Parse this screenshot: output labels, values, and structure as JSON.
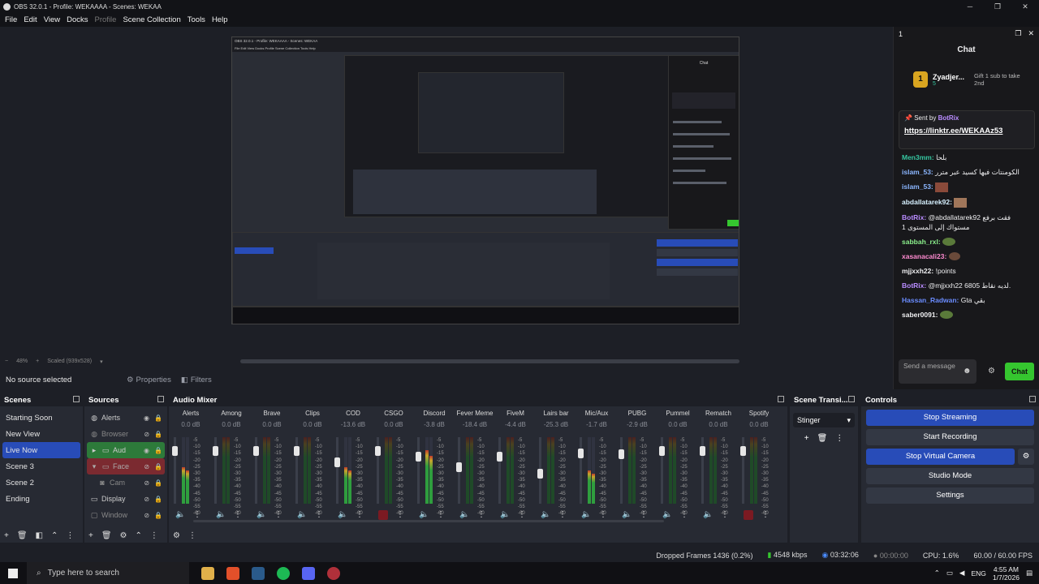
{
  "window": {
    "title": "OBS 32.0.1 - Profile: WEKAAAA - Scenes: WEKAA",
    "min_glyph": "─",
    "max_glyph": "❐",
    "close_glyph": "✕"
  },
  "menu": [
    "File",
    "Edit",
    "View",
    "Docks",
    "Profile",
    "Scene Collection",
    "Tools",
    "Help"
  ],
  "preview": {
    "zoom": "48%",
    "scaled": "Scaled (939x528)",
    "nested_title": "OBS 32.0.1 - Profile: WEKAAAA - Scenes: WEKAA",
    "nested_menu": "File Edit View Docks Profile Scene Collection Tools Help",
    "nested_chat_title": "Chat"
  },
  "source_toolbar": {
    "no_source": "No source selected",
    "properties": "Properties",
    "filters": "Filters"
  },
  "chat": {
    "dock_number": "1",
    "title": "Chat",
    "gift_user": "Zyadjer...",
    "gift_count": "5",
    "gift_text": "Gift 1 sub to take 2nd",
    "pinned_by_label": "Sent by",
    "pinned_by_user": "BotRix",
    "pinned_url": "https://linktr.ee/WEKAAz53",
    "messages": [
      {
        "user": "Men3mm:",
        "text": "بلحا",
        "color": "#35c6a0"
      },
      {
        "user": "islam_53:",
        "text": "الكومنتات فيها كسيد عبر مترر",
        "color": "#8bb6ff"
      },
      {
        "user": "islam_53:",
        "text": "",
        "color": "#8bb6ff"
      },
      {
        "user": "abdallatarek92:",
        "text": "",
        "color": "#d6f0ff"
      },
      {
        "user": "BotRix:",
        "text": "@abdallatarek92 فقت برفع مستواك إلى المستوى 1",
        "color": "#b98cff"
      },
      {
        "user": "sabbah_rxl:",
        "text": "",
        "color": "#8bf08b"
      },
      {
        "user": "xasanacali23:",
        "text": "",
        "color": "#ff8bd0"
      },
      {
        "user": "mjjxxh22:",
        "text": "!points",
        "color": "#ffffff"
      },
      {
        "user": "BotRix:",
        "text": "@mjjxxh22 لديه نقاط 6805.",
        "color": "#b98cff"
      },
      {
        "user": "Hassan_Radwan:",
        "text": "Gta بقي",
        "color": "#6a8cff"
      },
      {
        "user": "saber0091:",
        "text": "",
        "color": "#ffffff"
      }
    ],
    "input_placeholder": "Send a message",
    "chat_button": "Chat"
  },
  "docks": {
    "scenes": {
      "title": "Scenes",
      "items": [
        "Starting Soon",
        "New View",
        "Live Now",
        "Scene 3",
        "Scene 2",
        "Ending"
      ],
      "selected": "Live Now"
    },
    "sources": {
      "title": "Sources",
      "items": [
        {
          "label": "Alerts",
          "icon": "browser-icon"
        },
        {
          "label": "Browser",
          "icon": "browser-icon"
        },
        {
          "label": "Aud",
          "icon": "folder-icon"
        },
        {
          "label": "Face",
          "icon": "folder-icon"
        },
        {
          "label": "Cam",
          "icon": "camera-icon"
        },
        {
          "label": "Display",
          "icon": "monitor-icon"
        },
        {
          "label": "Window",
          "icon": "window-icon"
        }
      ]
    },
    "mixer": {
      "title": "Audio Mixer",
      "channels": [
        {
          "name": "Alerts",
          "db": "0.0 dB",
          "level": 0.55,
          "vol": 0.85
        },
        {
          "name": "Among",
          "db": "0.0 dB",
          "level": 0.0,
          "vol": 0.85
        },
        {
          "name": "Brave",
          "db": "0.0 dB",
          "level": 0.0,
          "vol": 0.85
        },
        {
          "name": "Clips",
          "db": "0.0 dB",
          "level": 0.0,
          "vol": 0.85
        },
        {
          "name": "COD",
          "db": "-13.6 dB",
          "level": 0.55,
          "vol": 0.65
        },
        {
          "name": "CSGO",
          "db": "0.0 dB",
          "level": 0.0,
          "vol": 0.85
        },
        {
          "name": "Discord",
          "db": "-3.8 dB",
          "level": 0.8,
          "vol": 0.75
        },
        {
          "name": "Fever Meme",
          "db": "-18.4 dB",
          "level": 0.0,
          "vol": 0.55
        },
        {
          "name": "FiveM",
          "db": "-4.4 dB",
          "level": 0.0,
          "vol": 0.75
        },
        {
          "name": "Lairs bar",
          "db": "-25.3 dB",
          "level": 0.0,
          "vol": 0.45
        },
        {
          "name": "Mic/Aux",
          "db": "-1.7 dB",
          "level": 0.5,
          "vol": 0.8
        },
        {
          "name": "PUBG",
          "db": "-2.9 dB",
          "level": 0.0,
          "vol": 0.78
        },
        {
          "name": "Pummel",
          "db": "0.0 dB",
          "level": 0.0,
          "vol": 0.85
        },
        {
          "name": "Rematch",
          "db": "0.0 dB",
          "level": 0.0,
          "vol": 0.85
        },
        {
          "name": "Spotify",
          "db": "0.0 dB",
          "level": 0.0,
          "vol": 0.85
        }
      ],
      "scale": [
        "-5",
        "-10",
        "-15",
        "-20",
        "-25",
        "-30",
        "-35",
        "-40",
        "-45",
        "-50",
        "-55",
        "-60"
      ]
    },
    "transitions": {
      "title": "Scene Transi...",
      "selected": "Stinger"
    },
    "controls": {
      "title": "Controls",
      "stop_streaming": "Stop Streaming",
      "start_recording": "Start Recording",
      "stop_virtual_camera": "Stop Virtual Camera",
      "studio_mode": "Studio Mode",
      "settings": "Settings"
    }
  },
  "status": {
    "dropped": "Dropped Frames 1436 (0.2%)",
    "bitrate": "4548 kbps",
    "stream_time": "03:32:06",
    "rec_time": "00:00:00",
    "cpu": "CPU: 1.6%",
    "fps": "60.00 / 60.00 FPS"
  },
  "taskbar": {
    "search": "Type here to search",
    "lang": "ENG",
    "time": "4:55 AM",
    "date": "1/7/2026"
  },
  "colors": {
    "accent": "#284cb8",
    "chat_green": "#35c62f",
    "meter_green": "#2f9e3e",
    "meter_yellow": "#c7a42c",
    "meter_red": "#c0392b"
  }
}
